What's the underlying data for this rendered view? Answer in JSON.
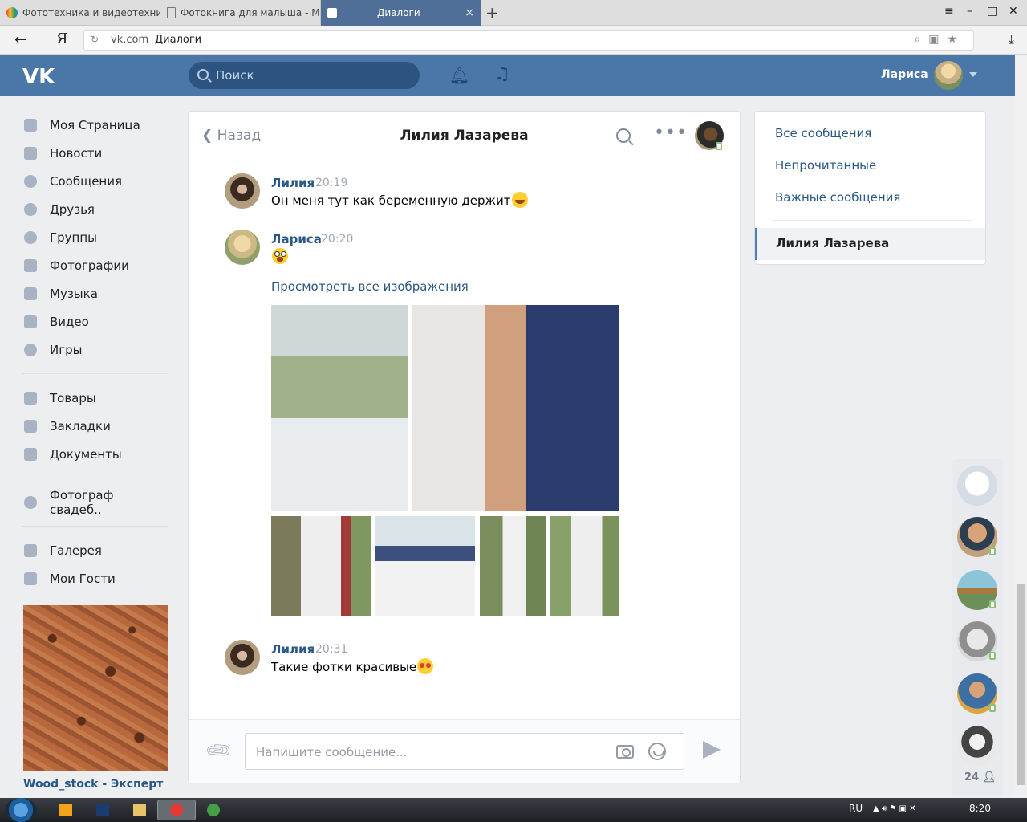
{
  "browser": {
    "tabs": [
      {
        "title": "Фототехника и видеотехни",
        "active": false
      },
      {
        "title": "Фотокнига для малыша - М",
        "active": false
      },
      {
        "title": "Диалоги",
        "active": true
      }
    ],
    "new_tab": "+",
    "close_tab": "×",
    "window_controls": [
      "≡",
      "–",
      "□",
      "✕"
    ],
    "back": "←",
    "logo": "Я",
    "address": {
      "domain": "vk.com",
      "page_title": "Диалоги"
    }
  },
  "vk": {
    "search_placeholder": "Поиск",
    "user_name": "Лариса",
    "accent_color": "#4a76a8"
  },
  "nav": {
    "group1": [
      {
        "label": "Моя Страница",
        "icon": "home-icon"
      },
      {
        "label": "Новости",
        "icon": "news-icon"
      },
      {
        "label": "Сообщения",
        "icon": "messages-icon"
      },
      {
        "label": "Друзья",
        "icon": "friends-icon"
      },
      {
        "label": "Группы",
        "icon": "groups-icon"
      },
      {
        "label": "Фотографии",
        "icon": "camera-icon"
      },
      {
        "label": "Музыка",
        "icon": "music-icon"
      },
      {
        "label": "Видео",
        "icon": "video-icon"
      },
      {
        "label": "Игры",
        "icon": "gamepad-icon"
      }
    ],
    "group2": [
      {
        "label": "Товары",
        "icon": "bag-icon"
      },
      {
        "label": "Закладки",
        "icon": "star-icon"
      },
      {
        "label": "Документы",
        "icon": "document-icon"
      }
    ],
    "group3": [
      {
        "label": "Фотограф свадеб..",
        "icon": "group-icon"
      }
    ],
    "group4": [
      {
        "label": "Галерея",
        "icon": "grid-icon"
      },
      {
        "label": "Мои Гости",
        "icon": "grid-icon"
      }
    ],
    "ad_title": "Wood_stock - Эксперт по"
  },
  "chat": {
    "back_label": "Назад",
    "contact_name": "Лилия Лазарева",
    "messages": [
      {
        "author": "Лилия",
        "time": "20:19",
        "text": "Он меня тут как беременную держит"
      },
      {
        "author": "Лариса",
        "time": "20:20",
        "text": ""
      },
      {
        "author": "Лилия",
        "time": "20:31",
        "text": "Такие фотки красивые"
      }
    ],
    "view_all_images": "Просмотреть все изображения",
    "composer_placeholder": "Напишите сообщение..."
  },
  "right_panel": {
    "items": [
      "Все сообщения",
      "Непрочитанные",
      "Важные сообщения"
    ],
    "selected": "Лилия Лазарева"
  },
  "friends_strip": {
    "count": "24"
  },
  "taskbar": {
    "lang": "RU",
    "time": "8:20"
  }
}
